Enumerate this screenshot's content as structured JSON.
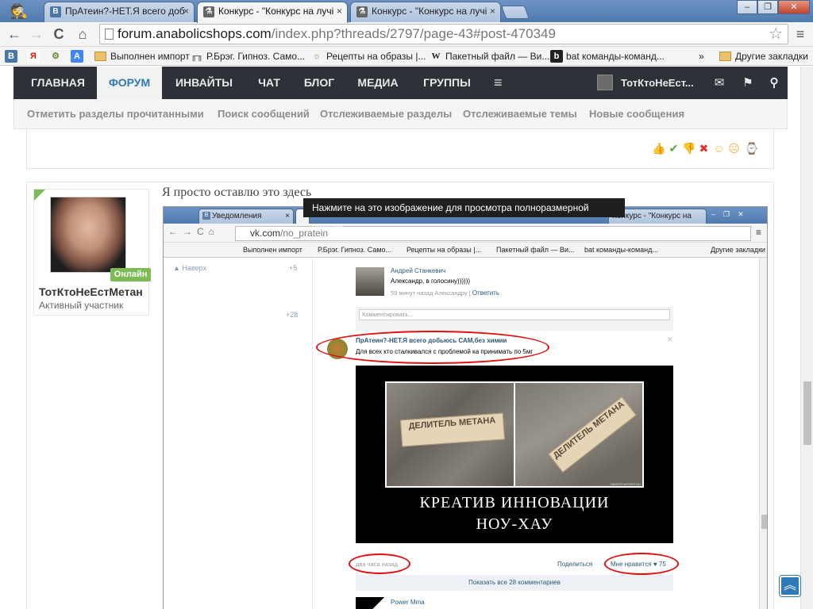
{
  "browser": {
    "tabs": [
      {
        "label": "ПрАтеин?-НЕТ.Я всего добі",
        "icon": "В"
      },
      {
        "label": "Конкурс - \"Конкурс на лучі",
        "icon": "⚗"
      },
      {
        "label": "Конкурс - \"Конкурс на лучі",
        "icon": "⚗"
      }
    ],
    "close_glyph": "×",
    "window_buttons": [
      "‒",
      "❐",
      "✕"
    ],
    "url_host": "forum.anabolicshops.com",
    "url_path": "/index.php?threads/2797/page-43#post-470349",
    "nav": {
      "back": "←",
      "forward": "→",
      "reload": "C",
      "home": "⌂",
      "star": "☆",
      "menu": "≡"
    },
    "bookmarks": [
      {
        "label": "",
        "icon": "В",
        "color": "#4a76a8"
      },
      {
        "label": "",
        "icon": "Я",
        "color": "#e61400"
      },
      {
        "label": "",
        "icon": "⚙",
        "color": "#6a8f3a"
      },
      {
        "label": "",
        "icon": "A",
        "color": "#4285f4"
      },
      {
        "label": "Выполнен импорт",
        "icon": "folder"
      },
      {
        "label": "Р.Брэг. Гипноз. Само...",
        "icon": "╓╖",
        "color": "#333"
      },
      {
        "label": "Рецепты на образы |...",
        "icon": "☼",
        "color": "#7a8a2a"
      },
      {
        "label": "Пакетный файл — Ви...",
        "icon": "W",
        "color": "#444"
      },
      {
        "label": "bat команды-команд...",
        "icon": "b",
        "color": "#222"
      }
    ],
    "bookmarks_more": "»",
    "other_bookmarks": "Другие закладки"
  },
  "forum": {
    "nav": [
      "ГЛАВНАЯ",
      "ФОРУМ",
      "ИНВАЙТЫ",
      "ЧАТ",
      "БЛОГ",
      "МЕДИА",
      "ГРУППЫ"
    ],
    "hamburger": "≡",
    "username": "ТотКтоНеЕст...",
    "icons": {
      "mail": "✉",
      "flag": "⚑",
      "search": "⚲"
    },
    "subnav": [
      "Отметить разделы прочитанными",
      "Поиск сообщений",
      "Отслеживаемые разделы",
      "Отслеживаемые темы",
      "Новые сообщения"
    ],
    "ratings": [
      {
        "glyph": "👍",
        "color": "#d9a06a"
      },
      {
        "glyph": "✔",
        "color": "#4caa3a"
      },
      {
        "glyph": "👎",
        "color": "#d9a06a"
      },
      {
        "glyph": "✖",
        "color": "#d33"
      },
      {
        "glyph": "☺",
        "color": "#e8b84a"
      },
      {
        "glyph": "☹",
        "color": "#e8b84a"
      },
      {
        "glyph": "⌚",
        "color": "#d9a030"
      }
    ],
    "post": {
      "author": "ТотКтоНеЕстМетан",
      "author_title": "Активный участник",
      "online": "Онлайн",
      "text": "Я просто оставлю это здесь"
    },
    "tooltip": "Нажмите на это изображение для просмотра полноразмерной версии.",
    "to_top": "︽"
  },
  "embedded": {
    "tabs": [
      {
        "label": "Уведомления"
      },
      {
        "label": ""
      },
      {
        "label": "Конкурс - \"Конкурс на"
      }
    ],
    "url_host": "vk.com",
    "url_path": "/no_pratein",
    "bookmarks": [
      "Выполнен импорт",
      "Р.Брэг. Гипноз. Само...",
      "Рецепты на образы |...",
      "Пакетный файл — Ви...",
      "bat команды-команд...",
      "Другие закладки"
    ],
    "left_nav": {
      "up": "Наверх",
      "counts": [
        "+5",
        "+28"
      ]
    },
    "comment": {
      "author": "Андрей Станкевич",
      "text": "Александр, в голосину))))))",
      "meta": "59 минут назад Александру",
      "reply": "Ответить",
      "placeholder": "Комментировать..."
    },
    "post": {
      "author": "ПрАтеин?-НЕТ.Я всего добьюсь САМ,без химии",
      "text": "Для всех кто сталкивался с проблемой ка принимать по 5мг",
      "close": "✕",
      "time": "два часа назад",
      "share": "Поделиться",
      "like": "Мне нравится",
      "likes": "75",
      "show_all": "Показать все 28 комментариев",
      "next_author": "Power Mma"
    },
    "demotivator": {
      "tag1": "ДЕЛИТЕЛЬ МЕТАНА",
      "tag2": "ДЕЛИТЕЛЬ МЕТАНА",
      "line1": "КРЕАТИВ  ИННОВАЦИИ",
      "line2": "НОУ-ХАУ",
      "site": "DEMOTIVATORS.RU"
    }
  }
}
